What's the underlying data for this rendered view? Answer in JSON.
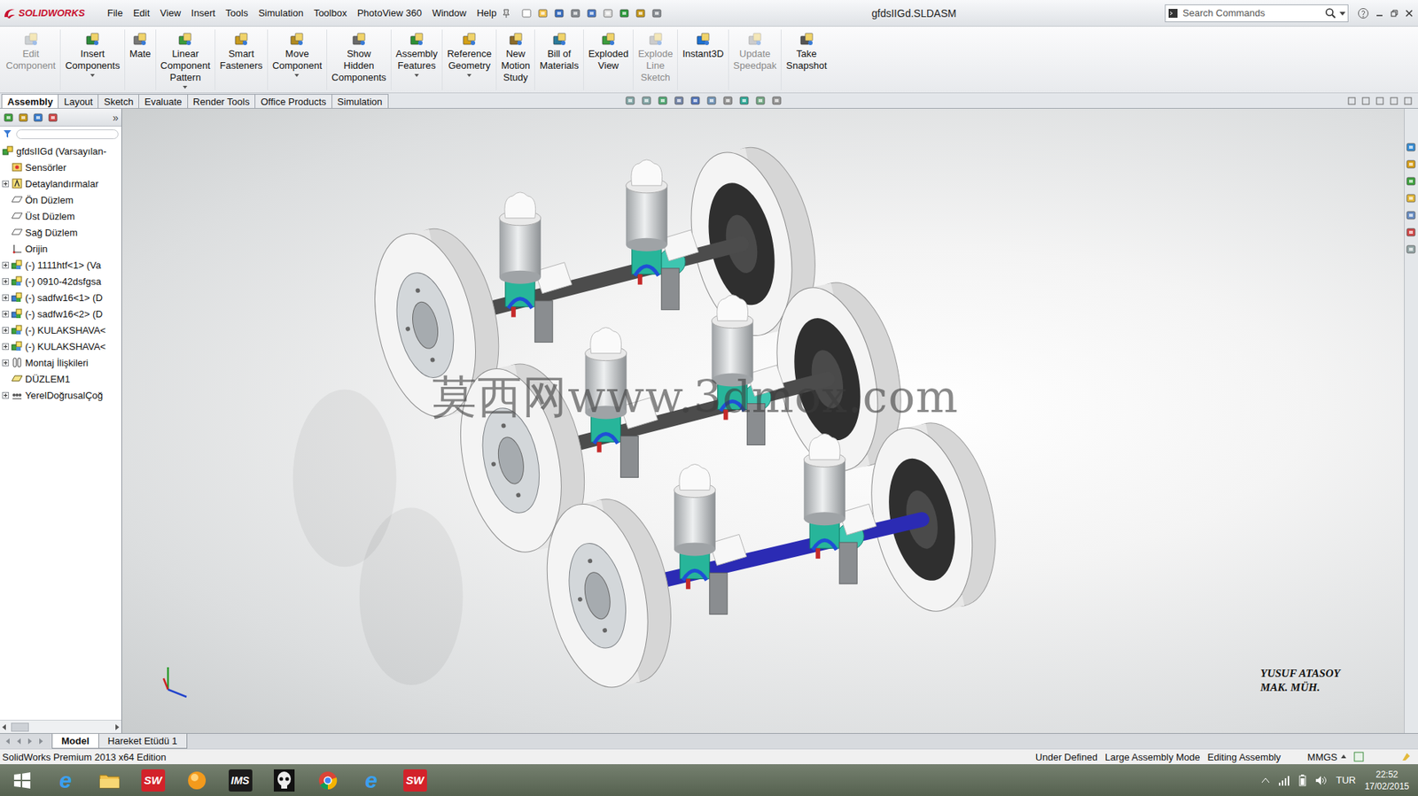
{
  "app": {
    "logo": "SOLIDWORKS",
    "title": "gfdsIIGd.SLDASM"
  },
  "menu": [
    "File",
    "Edit",
    "View",
    "Insert",
    "Tools",
    "Simulation",
    "Toolbox",
    "PhotoView 360",
    "Window",
    "Help"
  ],
  "search": {
    "placeholder": "Search Commands"
  },
  "ribbon": [
    {
      "lines": [
        "Edit",
        "Component"
      ],
      "disabled": true,
      "dropdown": false
    },
    {
      "lines": [
        "Insert",
        "Components"
      ],
      "disabled": false,
      "dropdown": true
    },
    {
      "lines": [
        "Mate"
      ],
      "disabled": false,
      "dropdown": false
    },
    {
      "lines": [
        "Linear",
        "Component",
        "Pattern"
      ],
      "disabled": false,
      "dropdown": true
    },
    {
      "lines": [
        "Smart",
        "Fasteners"
      ],
      "disabled": false,
      "dropdown": false
    },
    {
      "lines": [
        "Move",
        "Component"
      ],
      "disabled": false,
      "dropdown": true
    },
    {
      "lines": [
        "Show",
        "Hidden",
        "Components"
      ],
      "disabled": false,
      "dropdown": false
    },
    {
      "lines": [
        "Assembly",
        "Features"
      ],
      "disabled": false,
      "dropdown": true
    },
    {
      "lines": [
        "Reference",
        "Geometry"
      ],
      "disabled": false,
      "dropdown": true
    },
    {
      "lines": [
        "New",
        "Motion",
        "Study"
      ],
      "disabled": false,
      "dropdown": false
    },
    {
      "lines": [
        "Bill of",
        "Materials"
      ],
      "disabled": false,
      "dropdown": false
    },
    {
      "lines": [
        "Exploded",
        "View"
      ],
      "disabled": false,
      "dropdown": false
    },
    {
      "lines": [
        "Explode",
        "Line",
        "Sketch"
      ],
      "disabled": true,
      "dropdown": false
    },
    {
      "lines": [
        "Instant3D"
      ],
      "disabled": false,
      "dropdown": false
    },
    {
      "lines": [
        "Update",
        "Speedpak"
      ],
      "disabled": true,
      "dropdown": false
    },
    {
      "lines": [
        "Take",
        "Snapshot"
      ],
      "disabled": false,
      "dropdown": false
    }
  ],
  "tabs": [
    {
      "label": "Assembly",
      "selected": true
    },
    {
      "label": "Layout",
      "selected": false
    },
    {
      "label": "Sketch",
      "selected": false
    },
    {
      "label": "Evaluate",
      "selected": false
    },
    {
      "label": "Render Tools",
      "selected": false
    },
    {
      "label": "Office Products",
      "selected": false
    },
    {
      "label": "Simulation",
      "selected": false
    }
  ],
  "feature_manager": {
    "more": "»"
  },
  "tree": [
    {
      "label": "gfdsIIGd (Varsayılan-",
      "kind": "root",
      "expandable": false
    },
    {
      "label": "Sensörler",
      "kind": "sensor",
      "expandable": false
    },
    {
      "label": "Detaylandırmalar",
      "kind": "annotation",
      "expandable": true
    },
    {
      "label": "Ön Düzlem",
      "kind": "plane",
      "expandable": false
    },
    {
      "label": "Üst Düzlem",
      "kind": "plane",
      "expandable": false
    },
    {
      "label": "Sağ Düzlem",
      "kind": "plane",
      "expandable": false
    },
    {
      "label": "Orijin",
      "kind": "origin",
      "expandable": false
    },
    {
      "label": "(-) 1111htf<1> (Va",
      "kind": "part",
      "expandable": true
    },
    {
      "label": "(-) 0910-42dsfgsa",
      "kind": "part",
      "expandable": true
    },
    {
      "label": "(-) sadfw16<1> (D",
      "kind": "subassembly",
      "expandable": true
    },
    {
      "label": "(-) sadfw16<2> (D",
      "kind": "subassembly",
      "expandable": true
    },
    {
      "label": "(-) KULAKSHAVA<",
      "kind": "part",
      "expandable": true
    },
    {
      "label": "(-) KULAKSHAVA<",
      "kind": "part",
      "expandable": true
    },
    {
      "label": "Montaj İlişkileri",
      "kind": "mates",
      "expandable": true
    },
    {
      "label": "DÜZLEM1",
      "kind": "userplane",
      "expandable": false
    },
    {
      "label": "YerelDoğrusalÇoğ",
      "kind": "pattern",
      "expandable": true
    }
  ],
  "viewport": {
    "watermark": "莫西网www.3dmox.com",
    "signature": [
      "YUSUF ATASOY",
      "MAK. MÜH."
    ]
  },
  "bottom_tabs": [
    {
      "label": "Model",
      "selected": true
    },
    {
      "label": "Hareket Etüdü 1",
      "selected": false
    }
  ],
  "status_bar": {
    "edition": "SolidWorks Premium 2013 x64 Edition",
    "items": [
      "Under Defined",
      "Large Assembly Mode",
      "Editing Assembly"
    ],
    "units": "MMGS"
  },
  "taskbar": {
    "apps": [
      {
        "kind": "start"
      },
      {
        "kind": "ie",
        "glyph": "e"
      },
      {
        "kind": "folder"
      },
      {
        "kind": "sw",
        "glyph": "SW"
      },
      {
        "kind": "sun"
      },
      {
        "kind": "ims",
        "glyph": "IMS"
      },
      {
        "kind": "skull"
      },
      {
        "kind": "chrome"
      },
      {
        "kind": "ie",
        "glyph": "e"
      },
      {
        "kind": "sw",
        "glyph": "SW"
      }
    ],
    "language": "TUR",
    "time": "22:52",
    "date": "17/02/2015"
  }
}
